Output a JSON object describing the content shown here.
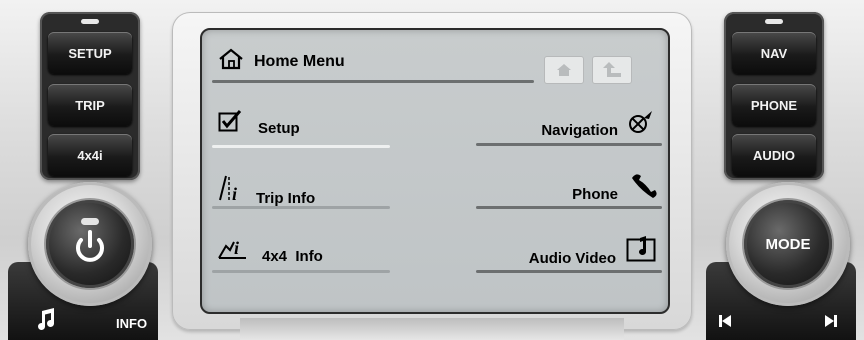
{
  "left_panel": {
    "buttons": [
      {
        "label": "SETUP"
      },
      {
        "label": "TRIP"
      },
      {
        "label": "4x4i"
      }
    ],
    "bottom": {
      "music_icon": "music-note-icon",
      "info_label": "INFO"
    }
  },
  "right_panel": {
    "buttons": [
      {
        "label": "NAV"
      },
      {
        "label": "PHONE"
      },
      {
        "label": "AUDIO"
      }
    ],
    "knob_label": "MODE",
    "bottom": {
      "prev_icon": "skip-previous-icon",
      "next_icon": "skip-next-icon"
    }
  },
  "screen": {
    "title": "Home Menu",
    "items_left": [
      {
        "label": "Setup",
        "icon": "checkbox-icon"
      },
      {
        "label": "Trip Info",
        "icon": "trip-info-icon"
      },
      {
        "label": "4x4  Info",
        "icon": "terrain-info-icon"
      }
    ],
    "items_right": [
      {
        "label": "Navigation",
        "icon": "navigation-compass-icon"
      },
      {
        "label": "Phone",
        "icon": "phone-handset-icon"
      },
      {
        "label": "Audio Video",
        "icon": "music-note-box-icon"
      }
    ],
    "mini_buttons": [
      "home-icon",
      "back-arrow-icon"
    ]
  }
}
